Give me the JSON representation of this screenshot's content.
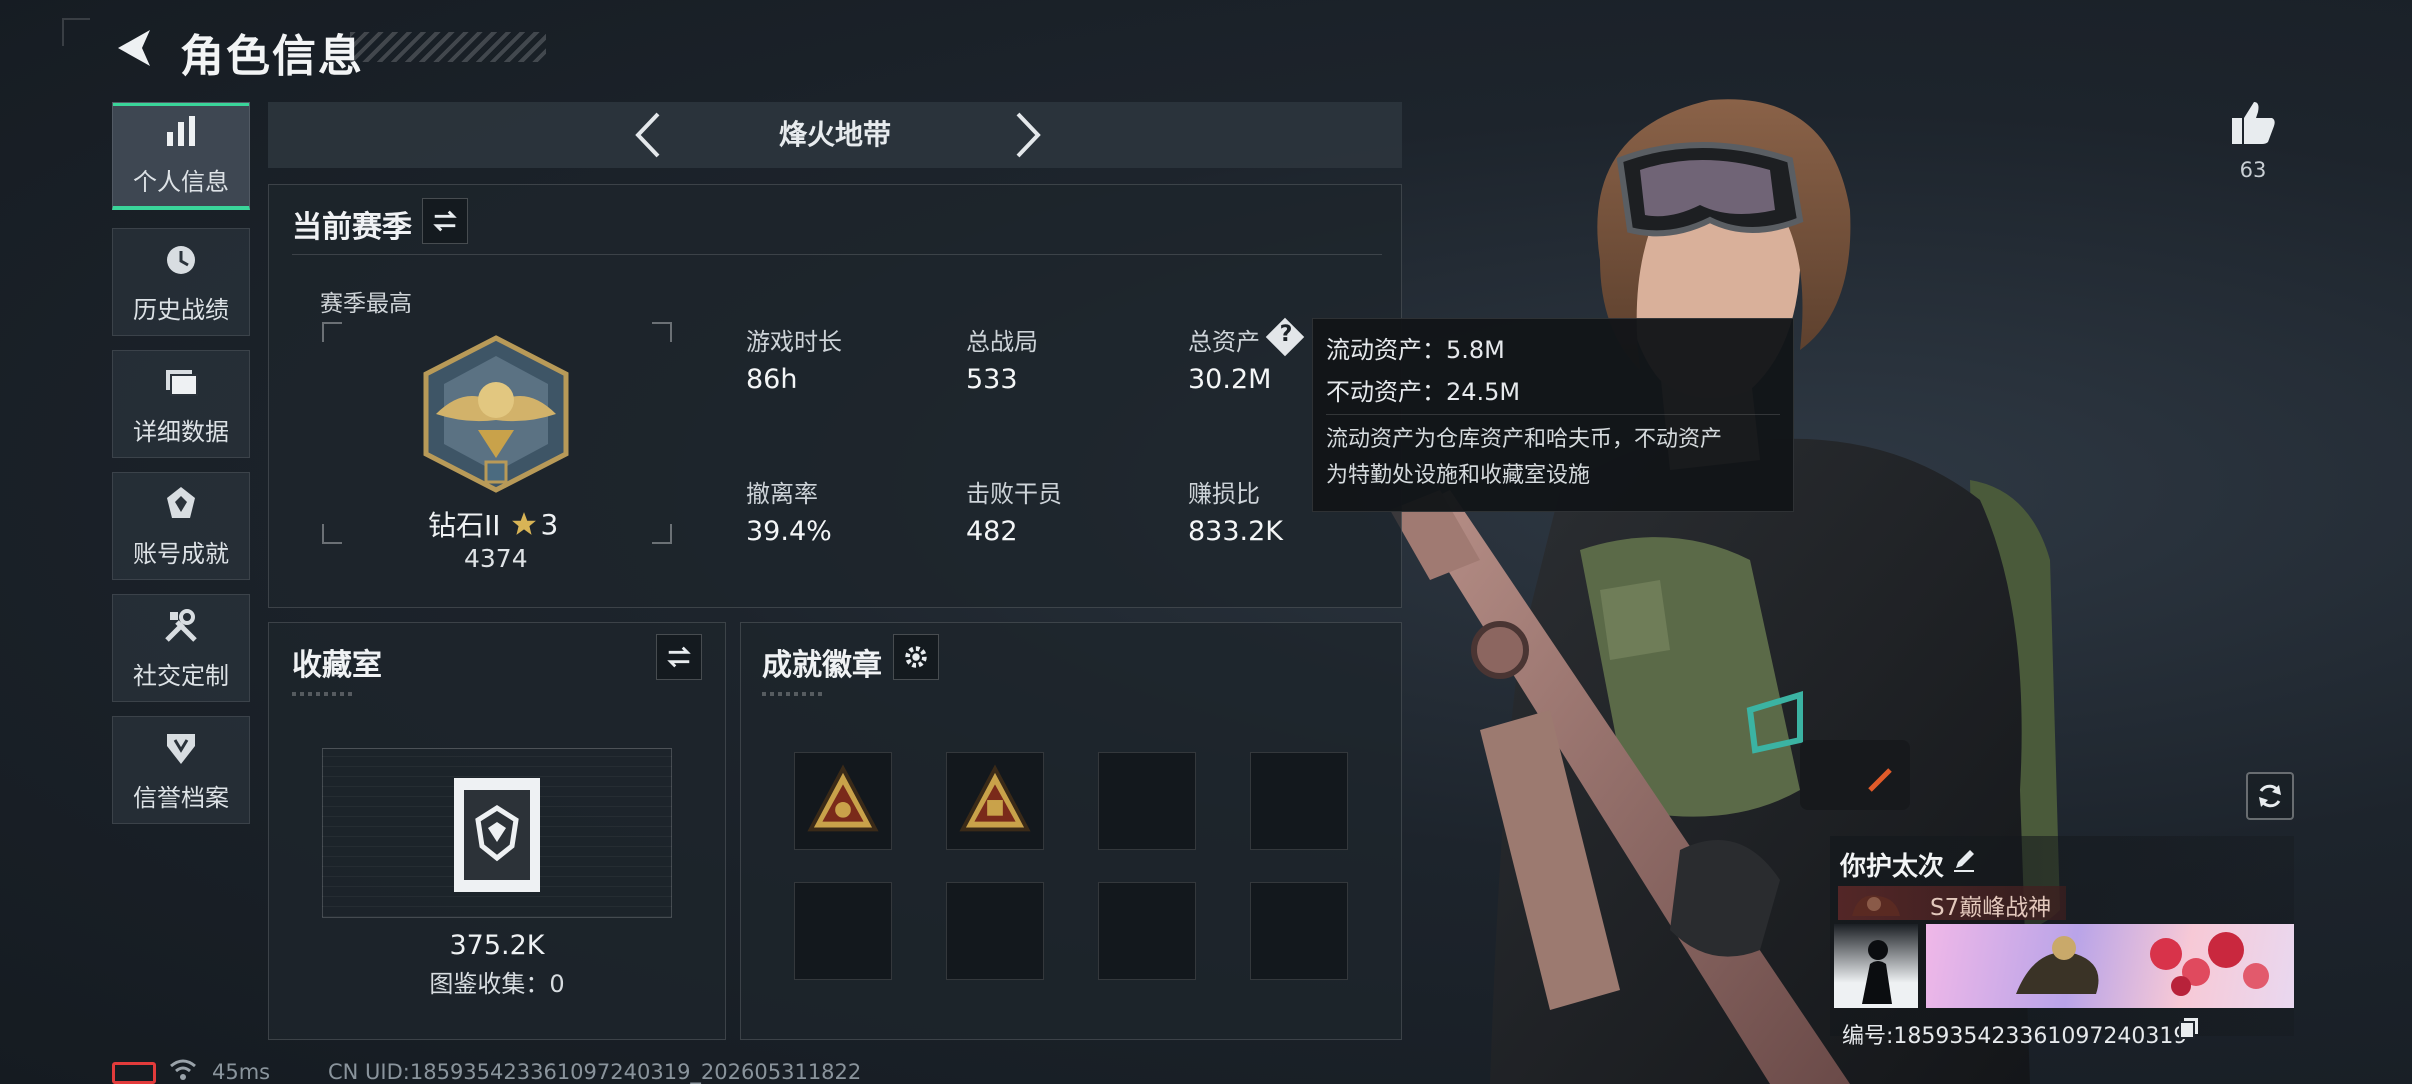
{
  "header": {
    "title": "角色信息"
  },
  "sidebar": {
    "items": [
      {
        "label": "个人信息",
        "icon": "bar-chart-icon",
        "active": true
      },
      {
        "label": "历史战绩",
        "icon": "history-icon",
        "active": false
      },
      {
        "label": "详细数据",
        "icon": "folder-icon",
        "active": false
      },
      {
        "label": "账号成就",
        "icon": "achievement-icon",
        "active": false
      },
      {
        "label": "社交定制",
        "icon": "tools-icon",
        "active": false
      },
      {
        "label": "信誉档案",
        "icon": "shield-icon",
        "active": false
      }
    ]
  },
  "mode": {
    "title": "烽火地带"
  },
  "season": {
    "title": "当前赛季",
    "best_label": "赛季最高",
    "rank_name": "钻石II",
    "rank_stars": "3",
    "rank_points": "4374",
    "stats": [
      {
        "label": "游戏时长",
        "value": "86h"
      },
      {
        "label": "总战局",
        "value": "533"
      },
      {
        "label": "总资产",
        "value": "30.2M"
      },
      {
        "label": "撤离率",
        "value": "39.4%"
      },
      {
        "label": "击败干员",
        "value": "482"
      },
      {
        "label": "赚损比",
        "value": "833.2K"
      }
    ]
  },
  "tooltip": {
    "liquid": "流动资产：5.8M",
    "fixed": "不动资产：24.5M",
    "desc_line1": "流动资产为仓库资产和哈夫币，不动资产",
    "desc_line2": "为特勤处设施和收藏室设施"
  },
  "collection": {
    "title": "收藏室",
    "value": "375.2K",
    "gallery": "图鉴收集：0"
  },
  "badges": {
    "title": "成就徽章"
  },
  "profile": {
    "likes": "63",
    "name": "你护太次",
    "title": "S7巅峰战神",
    "id": "编号:1859354233610972403​19"
  },
  "footer": {
    "ping": "45ms",
    "uid": "CN UID:1859354233610972403​19_202605311822"
  },
  "colors": {
    "accent": "#3ad59a",
    "battery": "#e23b3b",
    "gold": "#c9a24a"
  }
}
